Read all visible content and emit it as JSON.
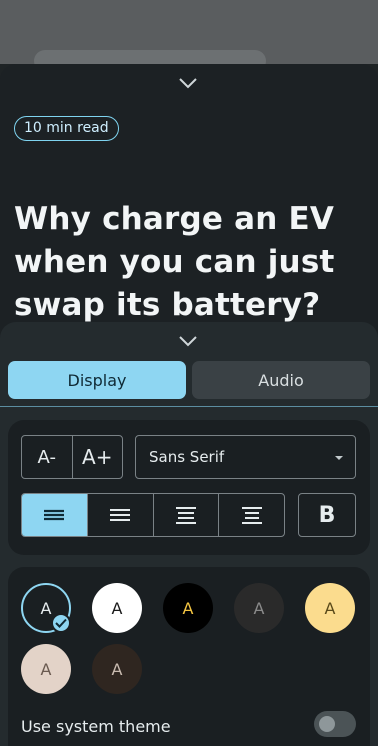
{
  "article": {
    "read_time": "10 min read",
    "headline": "Why charge an EV when you can just swap its battery?"
  },
  "tabs": [
    {
      "label": "Display",
      "active": true
    },
    {
      "label": "Audio",
      "active": false
    }
  ],
  "text_size": {
    "decrease_label": "A-",
    "increase_label": "A+"
  },
  "font": {
    "selected": "Sans Serif"
  },
  "alignment": {
    "options": [
      "justify",
      "left",
      "center",
      "right"
    ],
    "selected": "justify"
  },
  "bold_label": "B",
  "themes": [
    {
      "label": "A",
      "bg": "#1a1f22",
      "fg": "#e6ecee",
      "selected": true
    },
    {
      "label": "A",
      "bg": "#ffffff",
      "fg": "#1a1a1a",
      "selected": false
    },
    {
      "label": "A",
      "bg": "#000000",
      "fg": "#f4c542",
      "selected": false
    },
    {
      "label": "A",
      "bg": "#2a2a2a",
      "fg": "#8a8a8a",
      "selected": false
    },
    {
      "label": "A",
      "bg": "#fbdc8e",
      "fg": "#5a4a1a",
      "selected": false
    },
    {
      "label": "A",
      "bg": "#e3d3c8",
      "fg": "#6a5a50",
      "selected": false
    },
    {
      "label": "A",
      "bg": "#2f2620",
      "fg": "#c9bbb0",
      "selected": false
    }
  ],
  "system_theme": {
    "label": "Use system theme",
    "enabled": false
  },
  "colors": {
    "accent": "#8ed6f2",
    "sheet_bg": "#1c2124",
    "panel_bg": "#242b2e"
  }
}
